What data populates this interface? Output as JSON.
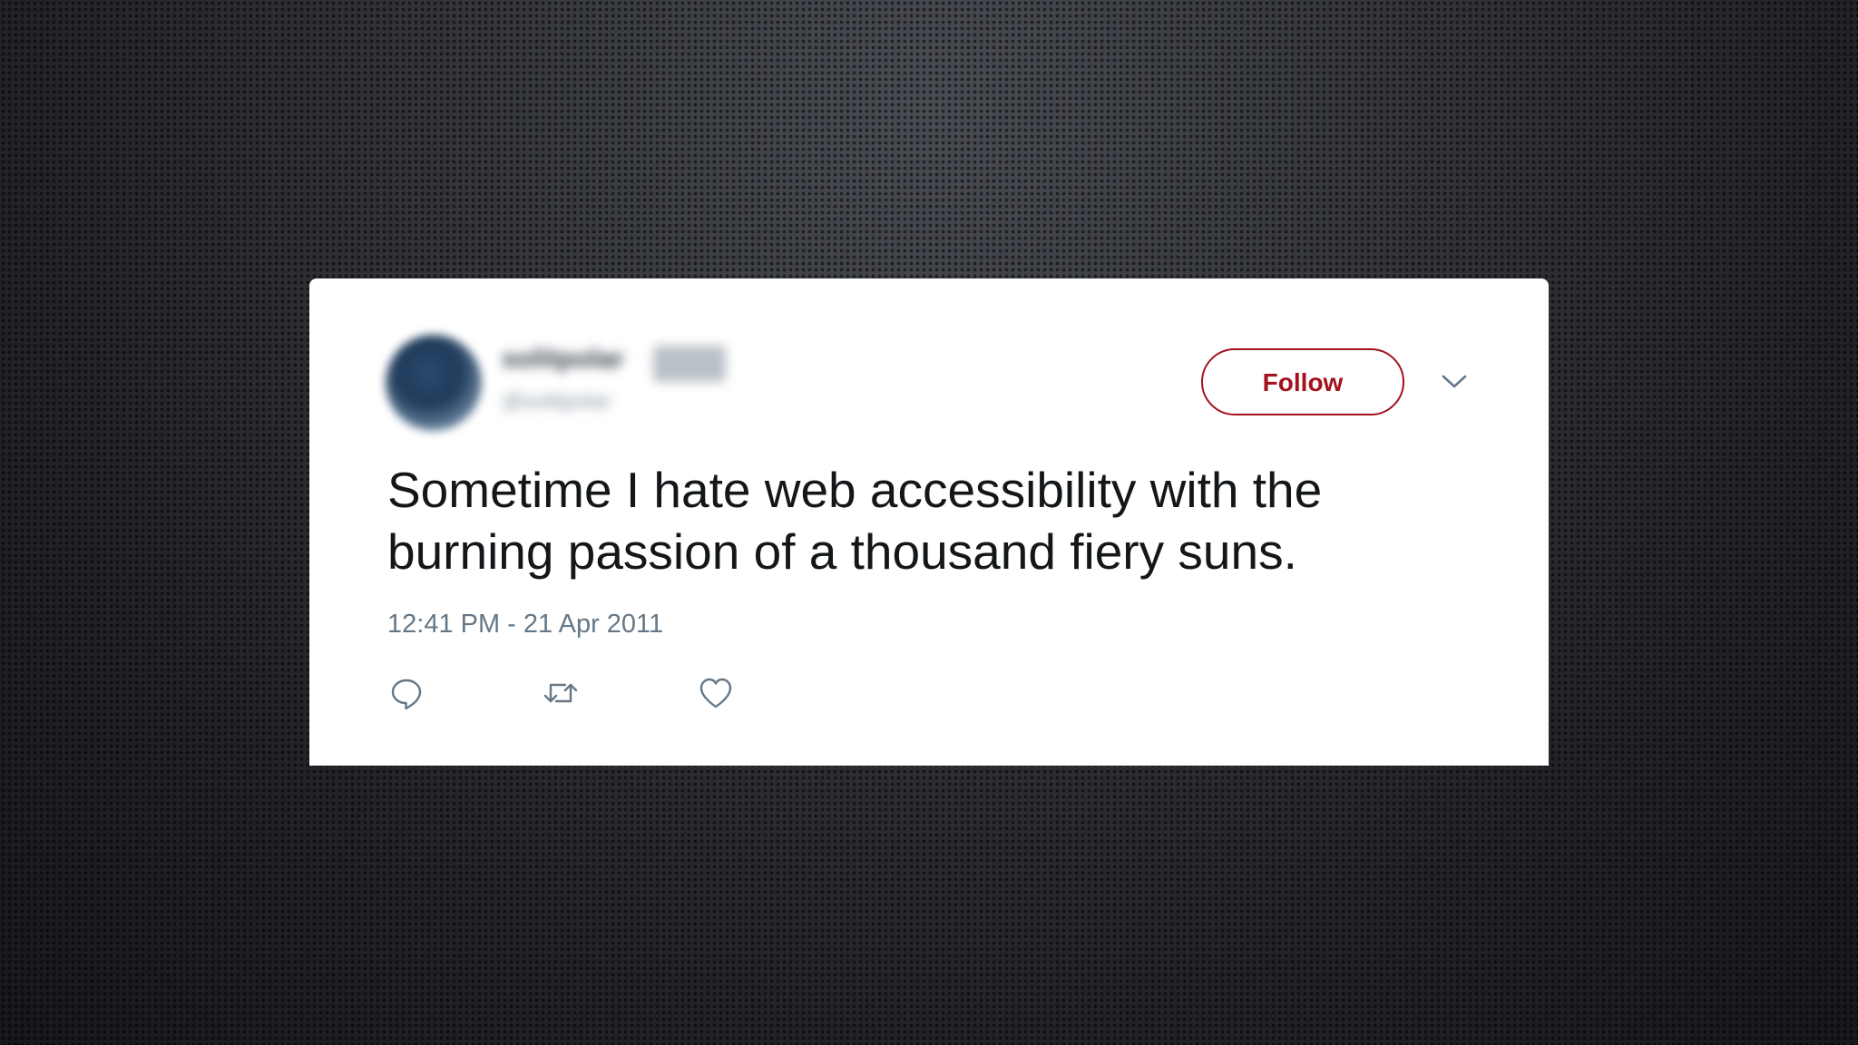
{
  "tweet": {
    "user": {
      "name": "solitpolar",
      "badge": "",
      "handle": "@solitpolar"
    },
    "follow_label": "Follow",
    "text": "Sometime I hate web accessibility with the burning passion of a thousand fiery suns.",
    "timestamp": "12:41 PM - 21 Apr 2011",
    "actions": {
      "reply_icon": "reply-icon",
      "retweet_icon": "retweet-icon",
      "like_icon": "heart-icon"
    }
  },
  "colors": {
    "accent": "#a3121e",
    "text": "#14171a",
    "muted": "#657786",
    "card": "#ffffff",
    "background": "#24262b"
  }
}
